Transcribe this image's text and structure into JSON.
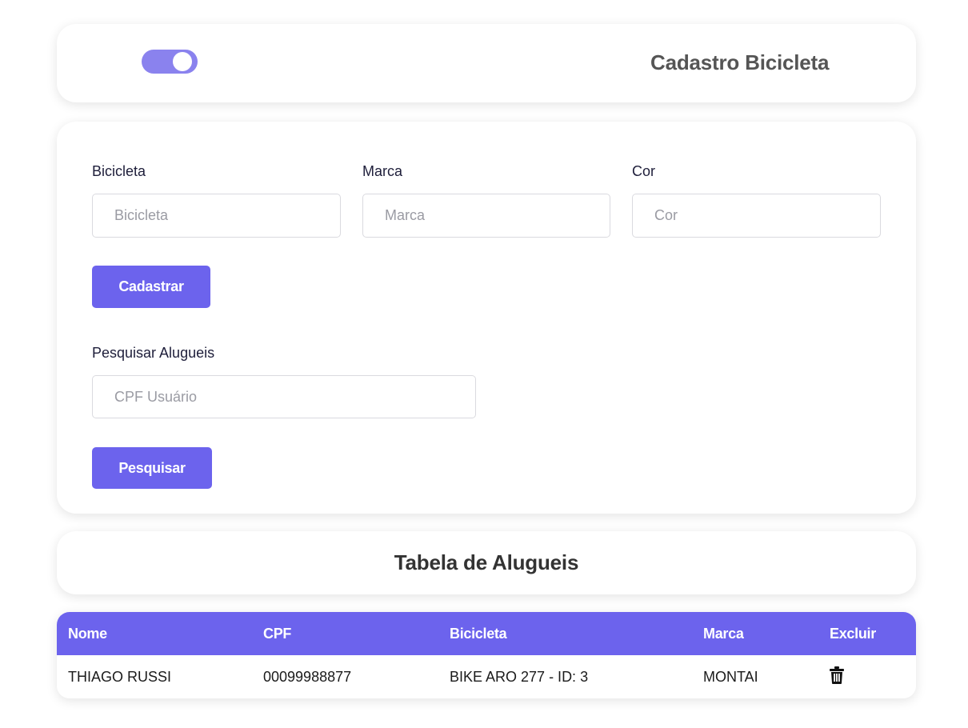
{
  "header": {
    "title": "Cadastro Bicicleta",
    "toggle_state": "on"
  },
  "form": {
    "fields": [
      {
        "label": "Bicicleta",
        "placeholder": "Bicicleta",
        "value": ""
      },
      {
        "label": "Marca",
        "placeholder": "Marca",
        "value": ""
      },
      {
        "label": "Cor",
        "placeholder": "Cor",
        "value": ""
      }
    ],
    "submit_label": "Cadastrar",
    "search": {
      "label": "Pesquisar Alugueis",
      "placeholder": "CPF Usuário",
      "value": "",
      "button_label": "Pesquisar"
    }
  },
  "table": {
    "title": "Tabela de Alugueis",
    "columns": [
      "Nome",
      "CPF",
      "Bicicleta",
      "Marca",
      "Excluir"
    ],
    "rows": [
      {
        "nome": "THIAGO RUSSI",
        "cpf": "00099988877",
        "bicicleta": "BIKE ARO 277 - ID: 3",
        "marca": "MONTAI",
        "delete_icon": "trash-icon"
      }
    ]
  },
  "colors": {
    "accent": "#6c63ed",
    "toggle": "#8a82ee",
    "header_text": "#555555",
    "title_text": "#333333"
  }
}
